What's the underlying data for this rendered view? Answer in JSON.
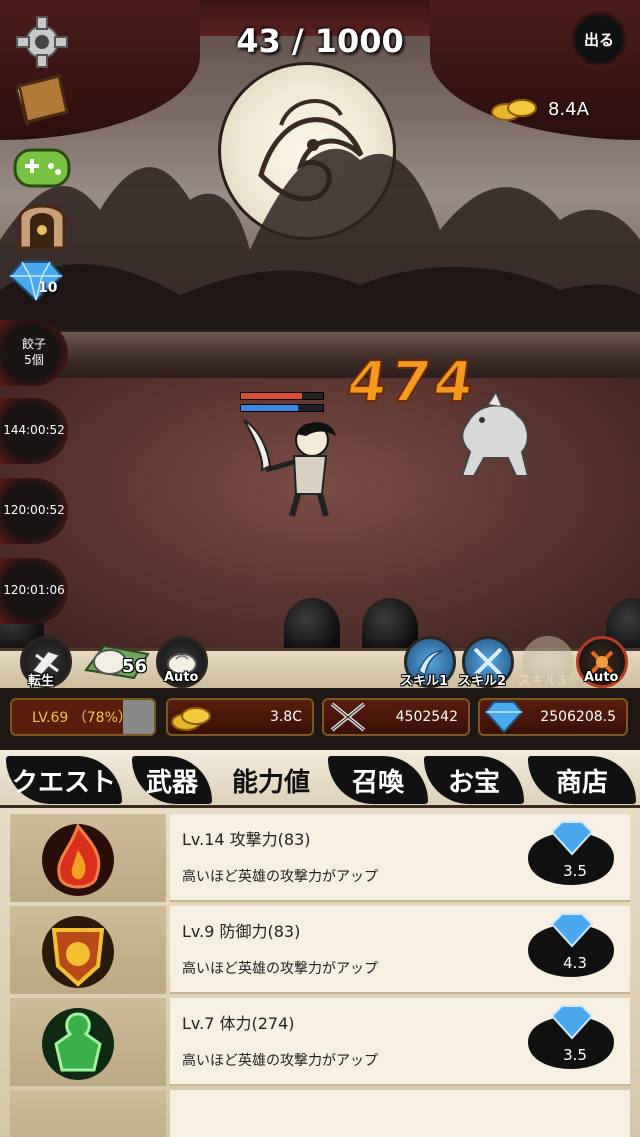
{
  "hud": {
    "stage_progress": "43 / 1000",
    "exit_label": "出る",
    "gold_top": "8.4A",
    "gems_side": "10",
    "dumpling_item": "餃子\n5個",
    "timers": [
      "144:00:52",
      "120:00:52",
      "120:01:06"
    ],
    "damage": "474"
  },
  "skill_bar": {
    "rebirth_label": "転生",
    "bun_count": "56",
    "auto_left_label": "Auto",
    "skill1_label": "スキル1",
    "skill2_label": "スキル2",
    "skill3_label": "スキル3",
    "auto_right_label": "Auto"
  },
  "stats": {
    "level": "LV.69 （78%）",
    "gold": "3.8C",
    "power": "4502542",
    "gems": "2506208.5"
  },
  "tabs": [
    {
      "label": "クエスト",
      "active": false
    },
    {
      "label": "武器",
      "active": false
    },
    {
      "label": "能力値",
      "active": true
    },
    {
      "label": "召喚",
      "active": false
    },
    {
      "label": "お宝",
      "active": false
    },
    {
      "label": "商店",
      "active": false
    }
  ],
  "abilities": [
    {
      "title": "Lv.14 攻撃力(83)",
      "desc": "高いほど英雄の攻撃力がアップ",
      "cost": "3.5",
      "icon": "fire-emblem-icon",
      "color": "#d8301c"
    },
    {
      "title": "Lv.9 防御力(83)",
      "desc": "高いほど英雄の攻撃力がアップ",
      "cost": "4.3",
      "icon": "shield-emblem-icon",
      "color": "#e0a020"
    },
    {
      "title": "Lv.7  体力(274)",
      "desc": "高いほど英雄の攻撃力がアップ",
      "cost": "3.5",
      "icon": "body-emblem-icon",
      "color": "#3bb04a"
    }
  ],
  "colors": {
    "accent_gold": "#f2c14a",
    "gem_blue": "#4aa8ee",
    "damage_orange": "#f39a1e"
  }
}
